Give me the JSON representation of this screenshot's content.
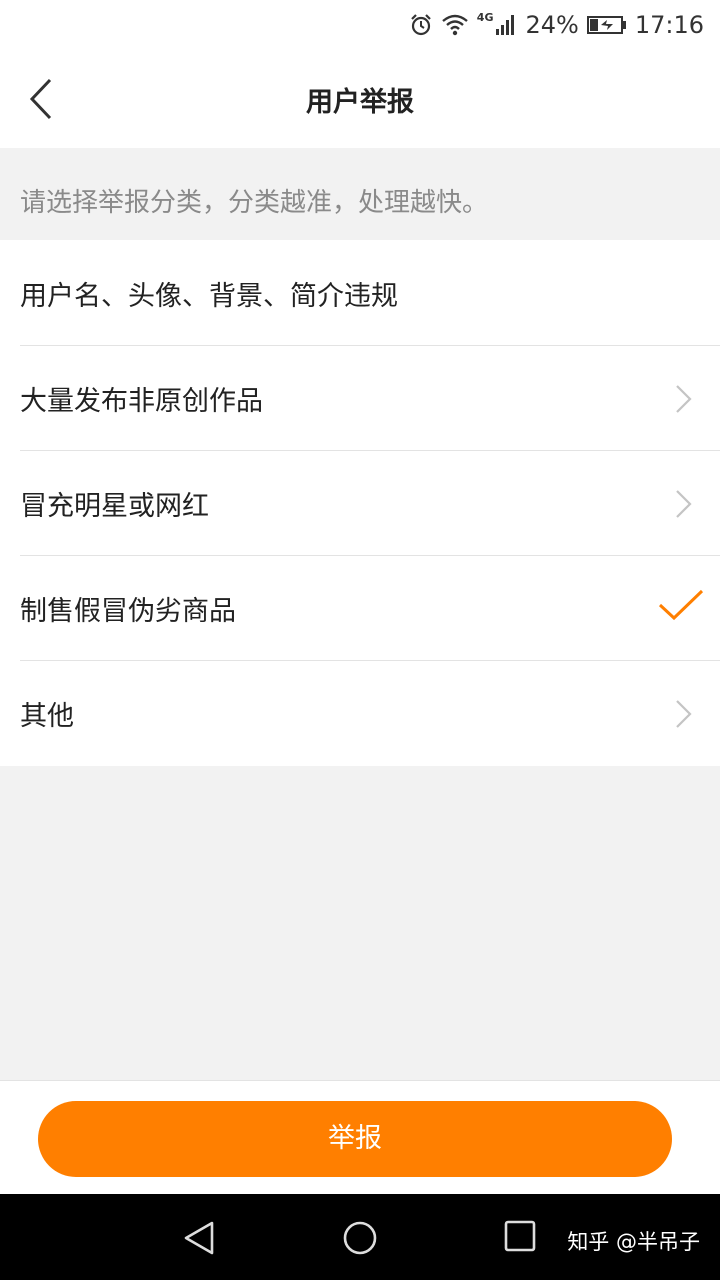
{
  "status_bar": {
    "network": "4G",
    "battery": "24%",
    "time": "17:16"
  },
  "header": {
    "title": "用户举报"
  },
  "hint": "请选择举报分类，分类越准，处理越快。",
  "options": [
    {
      "label": "用户名、头像、背景、简介违规",
      "indicator": "none"
    },
    {
      "label": "大量发布非原创作品",
      "indicator": "chevron"
    },
    {
      "label": "冒充明星或网红",
      "indicator": "chevron"
    },
    {
      "label": "制售假冒伪劣商品",
      "indicator": "check"
    },
    {
      "label": "其他",
      "indicator": "chevron"
    }
  ],
  "footer": {
    "button_label": "举报"
  },
  "colors": {
    "accent": "#ff7f00",
    "background": "#f2f2f2"
  },
  "watermark": "知乎 @半吊子"
}
